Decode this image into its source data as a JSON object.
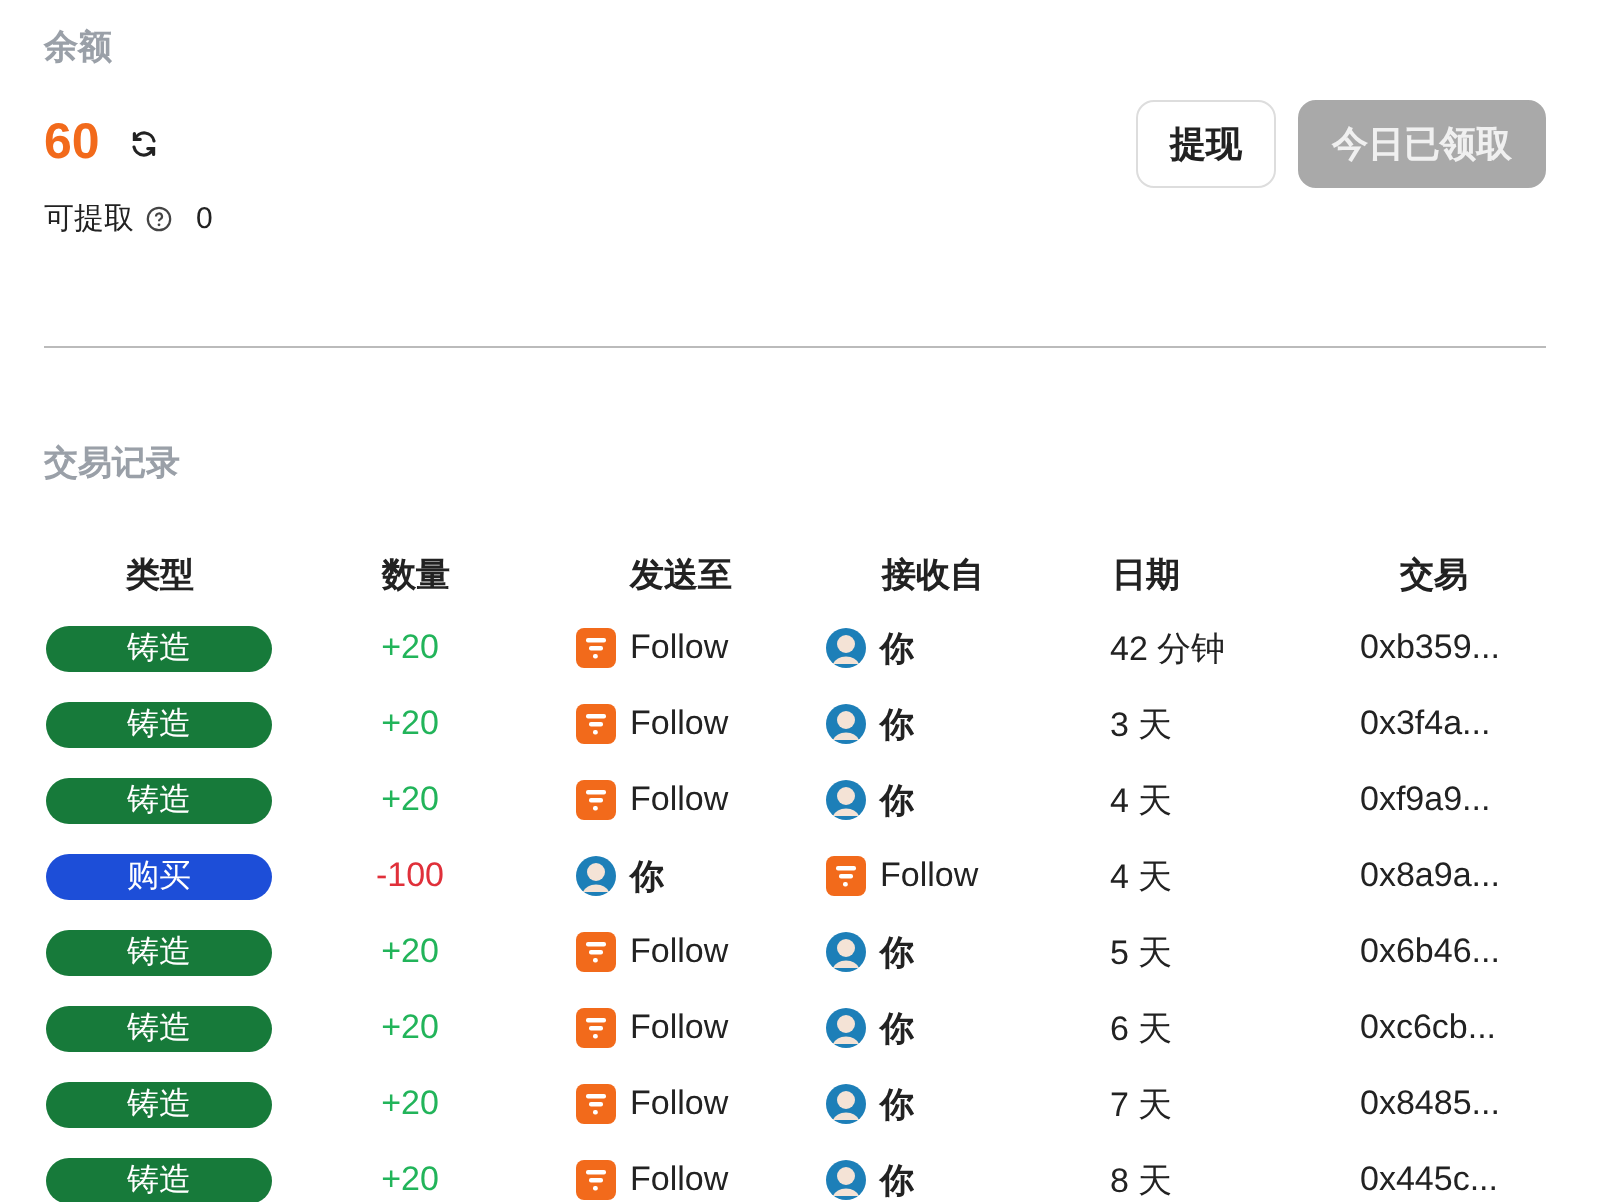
{
  "balance": {
    "title": "余额",
    "amount": "60",
    "withdrawable_label": "可提取",
    "withdrawable": "0"
  },
  "buttons": [
    {
      "label": "提现",
      "disabled": false
    },
    {
      "label": "今日已领取",
      "disabled": true
    }
  ],
  "transactions": {
    "title": "交易记录",
    "columns": [
      "类型",
      "数量",
      "发送至",
      "接收自",
      "日期",
      "交易"
    ],
    "rows": [
      {
        "kind": "mint",
        "type": "铸造",
        "amount": "+20",
        "to": {
          "kind": "app",
          "name": "Follow"
        },
        "from": {
          "kind": "user",
          "name": "你"
        },
        "date": "42 分钟",
        "tx": "0xb359..."
      },
      {
        "kind": "mint",
        "type": "铸造",
        "amount": "+20",
        "to": {
          "kind": "app",
          "name": "Follow"
        },
        "from": {
          "kind": "user",
          "name": "你"
        },
        "date": "3 天",
        "tx": "0x3f4a..."
      },
      {
        "kind": "mint",
        "type": "铸造",
        "amount": "+20",
        "to": {
          "kind": "app",
          "name": "Follow"
        },
        "from": {
          "kind": "user",
          "name": "你"
        },
        "date": "4 天",
        "tx": "0xf9a9..."
      },
      {
        "kind": "buy",
        "type": "购买",
        "amount": "-100",
        "to": {
          "kind": "user",
          "name": "你"
        },
        "from": {
          "kind": "app",
          "name": "Follow"
        },
        "date": "4 天",
        "tx": "0x8a9a..."
      },
      {
        "kind": "mint",
        "type": "铸造",
        "amount": "+20",
        "to": {
          "kind": "app",
          "name": "Follow"
        },
        "from": {
          "kind": "user",
          "name": "你"
        },
        "date": "5 天",
        "tx": "0x6b46..."
      },
      {
        "kind": "mint",
        "type": "铸造",
        "amount": "+20",
        "to": {
          "kind": "app",
          "name": "Follow"
        },
        "from": {
          "kind": "user",
          "name": "你"
        },
        "date": "6 天",
        "tx": "0xc6cb..."
      },
      {
        "kind": "mint",
        "type": "铸造",
        "amount": "+20",
        "to": {
          "kind": "app",
          "name": "Follow"
        },
        "from": {
          "kind": "user",
          "name": "你"
        },
        "date": "7 天",
        "tx": "0x8485..."
      },
      {
        "kind": "mint",
        "type": "铸造",
        "amount": "+20",
        "to": {
          "kind": "app",
          "name": "Follow"
        },
        "from": {
          "kind": "user",
          "name": "你"
        },
        "date": "8 天",
        "tx": "0x445c..."
      }
    ]
  }
}
